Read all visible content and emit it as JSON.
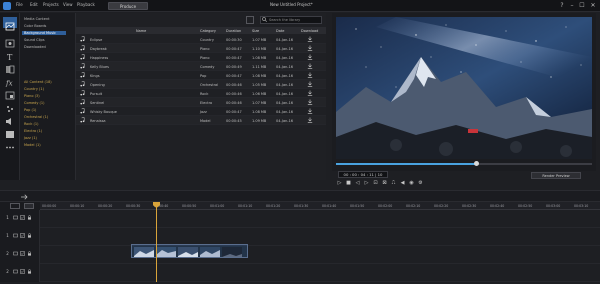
{
  "menu": {
    "items": [
      "File",
      "Edit",
      "Projects",
      "View",
      "Playback"
    ],
    "produce_label": "Produce",
    "project_title": "New Untitled Project*"
  },
  "window_controls": [
    "?",
    "–",
    "☐",
    "✕"
  ],
  "library_tree": {
    "items": [
      {
        "label": "Media Content",
        "level": "root"
      },
      {
        "label": "Color Boards",
        "level": "child"
      },
      {
        "label": "Background Music",
        "level": "child",
        "selected": true
      },
      {
        "label": "Sound Clips",
        "level": "child"
      },
      {
        "label": "Downloaded",
        "level": "child"
      },
      {
        "label": "All Content  (18)",
        "level": "filter"
      },
      {
        "label": "Country  (1)",
        "level": "filter"
      },
      {
        "label": "Piano  (3)",
        "level": "filter"
      },
      {
        "label": "Comedy  (1)",
        "level": "filter"
      },
      {
        "label": "Pop  (1)",
        "level": "filter"
      },
      {
        "label": "Orchestral  (1)",
        "level": "filter"
      },
      {
        "label": "Rock  (1)",
        "level": "filter"
      },
      {
        "label": "Electro  (1)",
        "level": "filter"
      },
      {
        "label": "Jazz  (1)",
        "level": "filter"
      },
      {
        "label": "Model  (1)",
        "level": "filter"
      }
    ]
  },
  "library": {
    "search_placeholder": "Search the library",
    "columns": [
      "Name",
      "Category",
      "Duration",
      "Size",
      "Date",
      "Download"
    ],
    "rows": [
      [
        "Eclipse",
        "Country",
        "00:00:30",
        "1.07 MB",
        "04-Jan-16"
      ],
      [
        "Daybreak",
        "Piano",
        "00:00:47",
        "1.10 MB",
        "04-Jan-16"
      ],
      [
        "Happiness",
        "Piano",
        "00:00:47",
        "1.08 MB",
        "04-Jan-16"
      ],
      [
        "Kelly Blues",
        "Comedy",
        "00:00:49",
        "1.11 MB",
        "04-Jan-16"
      ],
      [
        "Kings",
        "Pop",
        "00:00:47",
        "1.08 MB",
        "04-Jan-16"
      ],
      [
        "Opening",
        "Orchestral",
        "00:00:46",
        "1.05 MB",
        "04-Jan-16"
      ],
      [
        "Pursuit",
        "Rock",
        "00:00:46",
        "1.06 MB",
        "04-Jan-16"
      ],
      [
        "Sentinel",
        "Electro",
        "00:00:46",
        "1.07 MB",
        "04-Jan-16"
      ],
      [
        "Whisky Bouque",
        "Jazz",
        "00:00:47",
        "1.08 MB",
        "04-Jan-16"
      ],
      [
        "Renaissa",
        "Model",
        "00:00:45",
        "1.09 MB",
        "04-Jan-16"
      ]
    ]
  },
  "preview": {
    "timecode": "00 : 00 : 04 : 11 | 10",
    "render_label": "Render Preview",
    "progress": 0.55,
    "controls": [
      "▷",
      "■",
      "◁",
      "▷",
      "⊡",
      "⊠",
      "⎍",
      "◀",
      "◉",
      "⚙"
    ]
  },
  "timeline": {
    "ruler_labels": [
      "00:00:00",
      "00:00:10",
      "00:00:20",
      "00:00:30",
      "00:00:40",
      "00:00:50",
      "00:01:00",
      "00:01:10",
      "00:01:20",
      "00:01:30",
      "00:01:40",
      "00:01:50",
      "00:02:00",
      "00:02:10",
      "00:02:20",
      "00:02:30",
      "00:02:40",
      "00:02:50",
      "00:03:00",
      "00:03:10"
    ],
    "tracks": [
      "1",
      "1",
      "2",
      "2"
    ]
  },
  "colors": {
    "accent": "#4aa3e0",
    "playhead": "#d9a43a",
    "selected": "#2f5f9a",
    "filter_text": "#c9a64e"
  }
}
